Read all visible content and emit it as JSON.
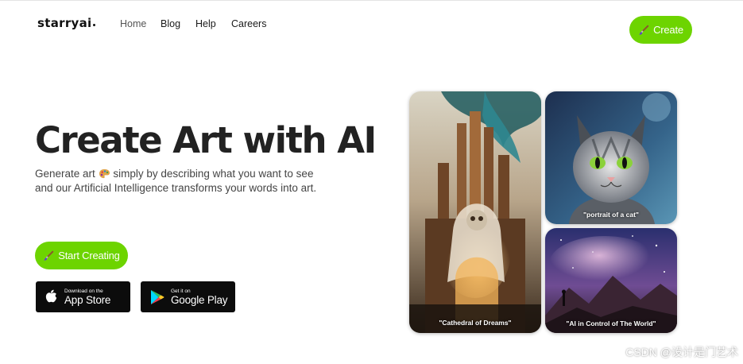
{
  "header": {
    "logo": "starryai",
    "nav": [
      "Home",
      "Blog",
      "Help",
      "Careers"
    ],
    "create_label": "Create"
  },
  "hero": {
    "title": "Create Art with AI",
    "subtitle_part1": "Generate art",
    "subtitle_part2": "simply by describing what you want to see",
    "subtitle_line2": "and our Artificial Intelligence transforms your words into art.",
    "start_label": "Start Creating"
  },
  "stores": {
    "apple_small": "Download on the",
    "apple_big": "App Store",
    "google_small": "Get it on",
    "google_big": "Google Play"
  },
  "gallery": {
    "captions": [
      "\"Cathedral of Dreams\"",
      "\"portrait of a cat\"",
      "\"AI in Control of The World\""
    ]
  },
  "watermark": "CSDN @设计是门艺术",
  "colors": {
    "accent": "#6dd400",
    "text": "#222222",
    "store_badge": "#0c0c0c"
  },
  "icons": [
    "brush-icon",
    "palette-icon",
    "apple-icon",
    "google-play-icon"
  ]
}
